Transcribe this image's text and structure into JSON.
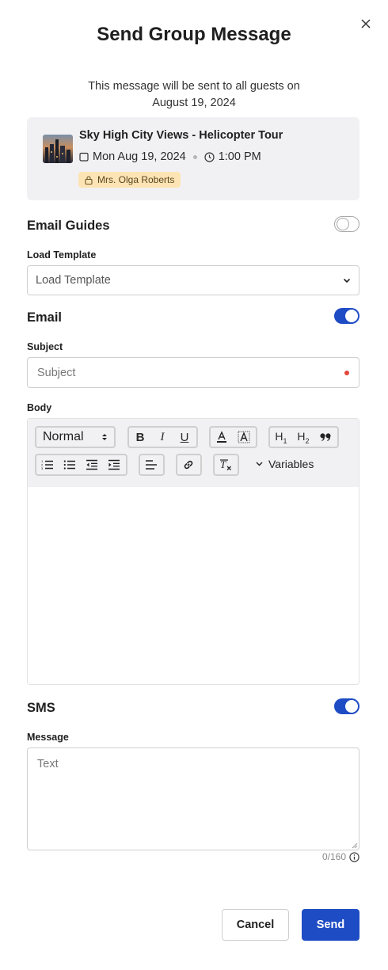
{
  "dialog": {
    "title": "Send Group Message",
    "intro_line1": "This message will be sent to all guests on",
    "intro_line2": "August 19, 2024"
  },
  "event": {
    "name": "Sky High City Views - Helicopter Tour",
    "date": "Mon Aug 19, 2024",
    "time": "1:00 PM",
    "guide": "Mrs. Olga Roberts"
  },
  "email_guides": {
    "label": "Email Guides",
    "enabled": false,
    "template_label": "Load Template",
    "template_value": "Load Template"
  },
  "email": {
    "label": "Email",
    "enabled": true,
    "subject_label": "Subject",
    "subject_placeholder": "Subject",
    "body_label": "Body",
    "toolbar": {
      "format_select": "Normal",
      "bold": "B",
      "italic": "I",
      "underline": "U",
      "h1": "H1",
      "h2": "H2",
      "variables": "Variables"
    }
  },
  "sms": {
    "label": "SMS",
    "enabled": true,
    "message_label": "Message",
    "message_placeholder": "Text",
    "counter": "0/160"
  },
  "actions": {
    "cancel": "Cancel",
    "send": "Send"
  },
  "colors": {
    "primary": "#1e4cc4",
    "badge_bg": "#fde4b4",
    "card_bg": "#f1f1f3",
    "required_dot": "#e2463c"
  },
  "icons": [
    "close-icon",
    "calendar-icon",
    "clock-icon",
    "lock-icon",
    "chevron-down-icon",
    "info-icon"
  ]
}
